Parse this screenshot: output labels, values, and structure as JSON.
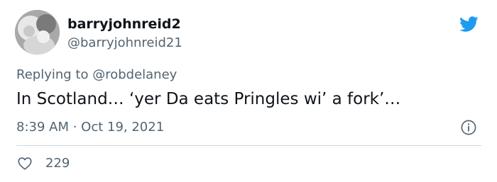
{
  "user": {
    "display_name": "barryjohnreid2",
    "handle": "@barryjohnreid21",
    "avatar_icon": "user-photo"
  },
  "reply": {
    "prefix": "Replying to ",
    "mention": "@robdelaney"
  },
  "tweet": {
    "text": "In Scotland… ‘yer Da eats Pringles wi’ a fork’…",
    "timestamp": "8:39 AM · Oct 19, 2021"
  },
  "stats": {
    "likes": "229"
  },
  "icons": {
    "logo": "twitter-bird-icon",
    "info": "info-icon",
    "like": "heart-icon"
  },
  "colors": {
    "brand": "#1d9bf0",
    "text": "#0f1419",
    "secondary": "#536471",
    "divider": "#cfd9de"
  }
}
